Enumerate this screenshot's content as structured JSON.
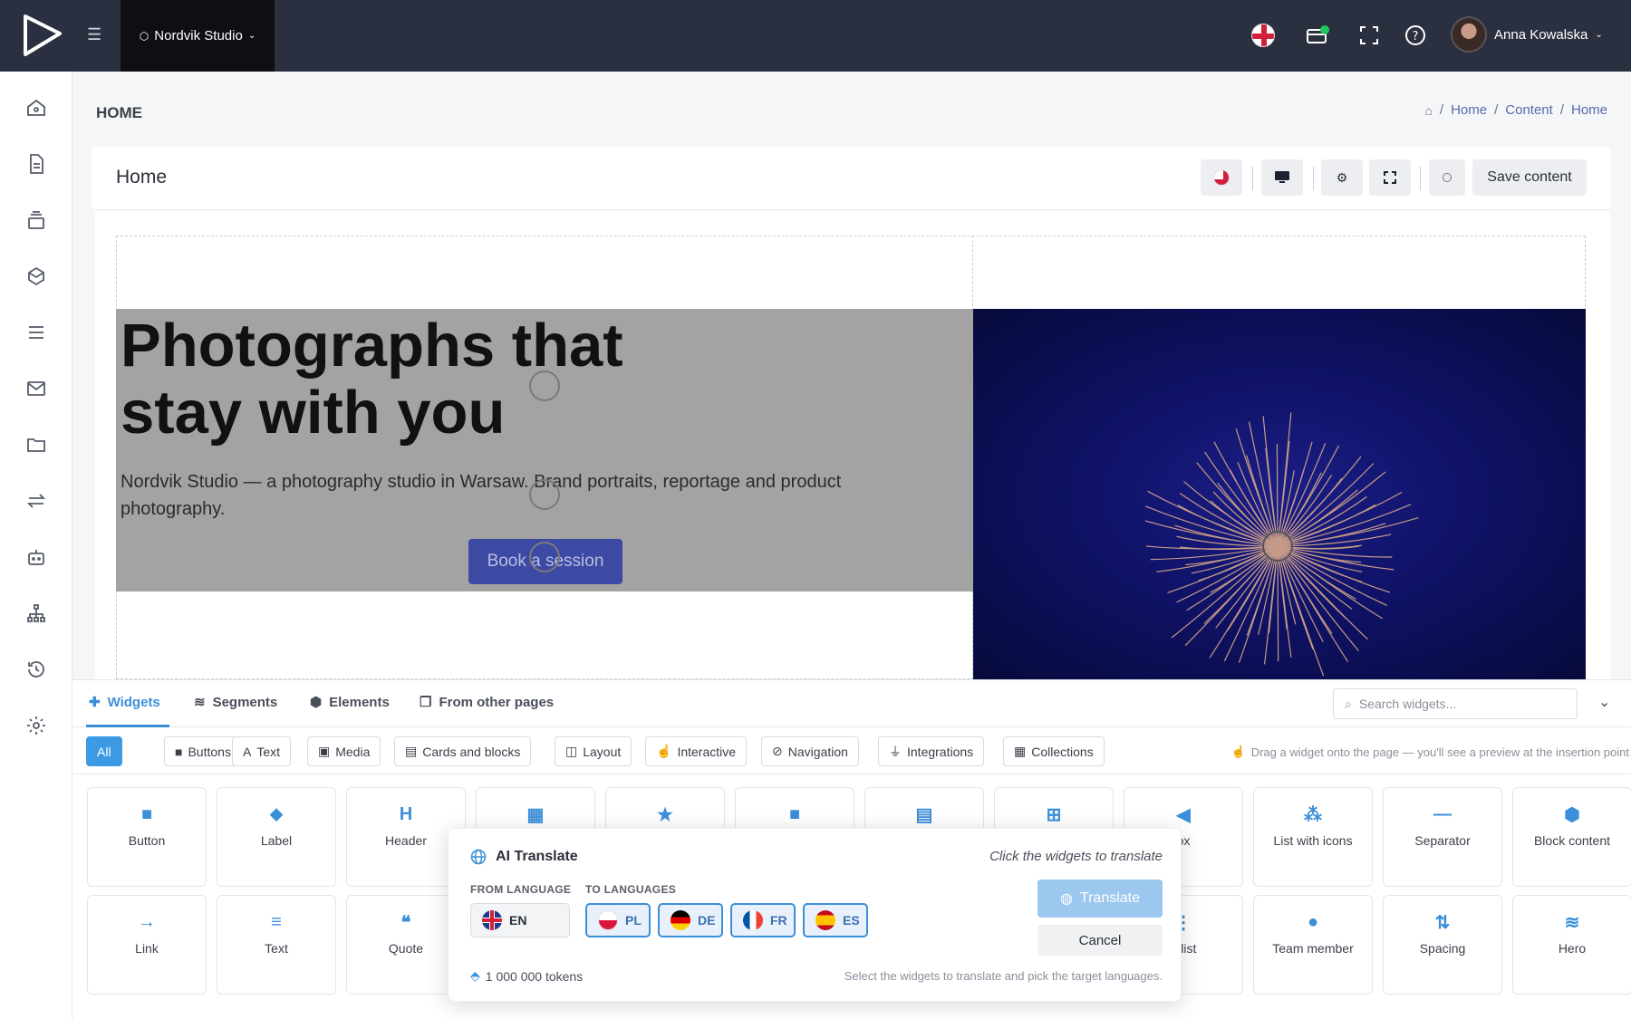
{
  "topbar": {
    "studio_label": "Nordvik Studio",
    "user_name": "Anna Kowalska",
    "notification_color": "#22c55e"
  },
  "page": {
    "title": "HOME",
    "breadcrumb": [
      "Home",
      "Content",
      "Home"
    ]
  },
  "editor": {
    "title": "Home",
    "save_label": "Save content"
  },
  "hero": {
    "heading": "Photographs that stay with you",
    "paragraph": "Nordvik Studio — a photography studio in Warsaw. Brand portraits, reportage and product photography.",
    "button_label": "Book a session"
  },
  "panel": {
    "tabs": [
      "Widgets",
      "Segments",
      "Elements",
      "From other pages"
    ],
    "search_placeholder": "Search widgets...",
    "filters": [
      "All",
      "Buttons",
      "Text",
      "Media",
      "Cards and blocks",
      "Layout",
      "Interactive",
      "Navigation",
      "Integrations",
      "Collections"
    ],
    "hint": "Drag a widget onto the page — you'll see a preview at the insertion point",
    "widgets_row1": [
      {
        "label": "Button",
        "icon": "square-icon"
      },
      {
        "label": "Label",
        "icon": "tag-icon"
      },
      {
        "label": "Header",
        "icon": "heading-icon"
      },
      {
        "label": "",
        "icon": "table-icon"
      },
      {
        "label": "",
        "icon": "star-icon"
      },
      {
        "label": "",
        "icon": "video-icon"
      },
      {
        "label": "",
        "icon": "pdf-icon"
      },
      {
        "label": "",
        "icon": "grid-icon"
      },
      {
        "label": "ox",
        "icon": "megaphone-icon"
      },
      {
        "label": "List with icons",
        "icon": "icons-list-icon"
      },
      {
        "label": "Separator",
        "icon": "separator-icon"
      },
      {
        "label": "Block content",
        "icon": "cube-icon"
      }
    ],
    "widgets_row2": [
      {
        "label": "Link",
        "icon": "arrow-right-icon"
      },
      {
        "label": "Text",
        "icon": "text-align-icon"
      },
      {
        "label": "Quote",
        "icon": "quote-icon"
      },
      {
        "label": "e list",
        "icon": "list-icon"
      },
      {
        "label": "Team member",
        "icon": "user-icon"
      },
      {
        "label": "Spacing",
        "icon": "spacing-icon"
      },
      {
        "label": "Hero",
        "icon": "layers-icon"
      }
    ]
  },
  "translate_modal": {
    "title": "AI Translate",
    "hint": "Click the widgets to translate",
    "from_label": "FROM LANGUAGE",
    "to_label": "TO LANGUAGES",
    "from_lang": "EN",
    "to_langs": [
      "PL",
      "DE",
      "FR",
      "ES"
    ],
    "translate_label": "Translate",
    "cancel_label": "Cancel",
    "tokens": "1 000 000 tokens",
    "footer": "Select the widgets to translate and pick the target languages."
  },
  "colors": {
    "accent": "#3b8fd9",
    "topbar": "#2b3040",
    "hero_button": "#3d4aa3"
  }
}
